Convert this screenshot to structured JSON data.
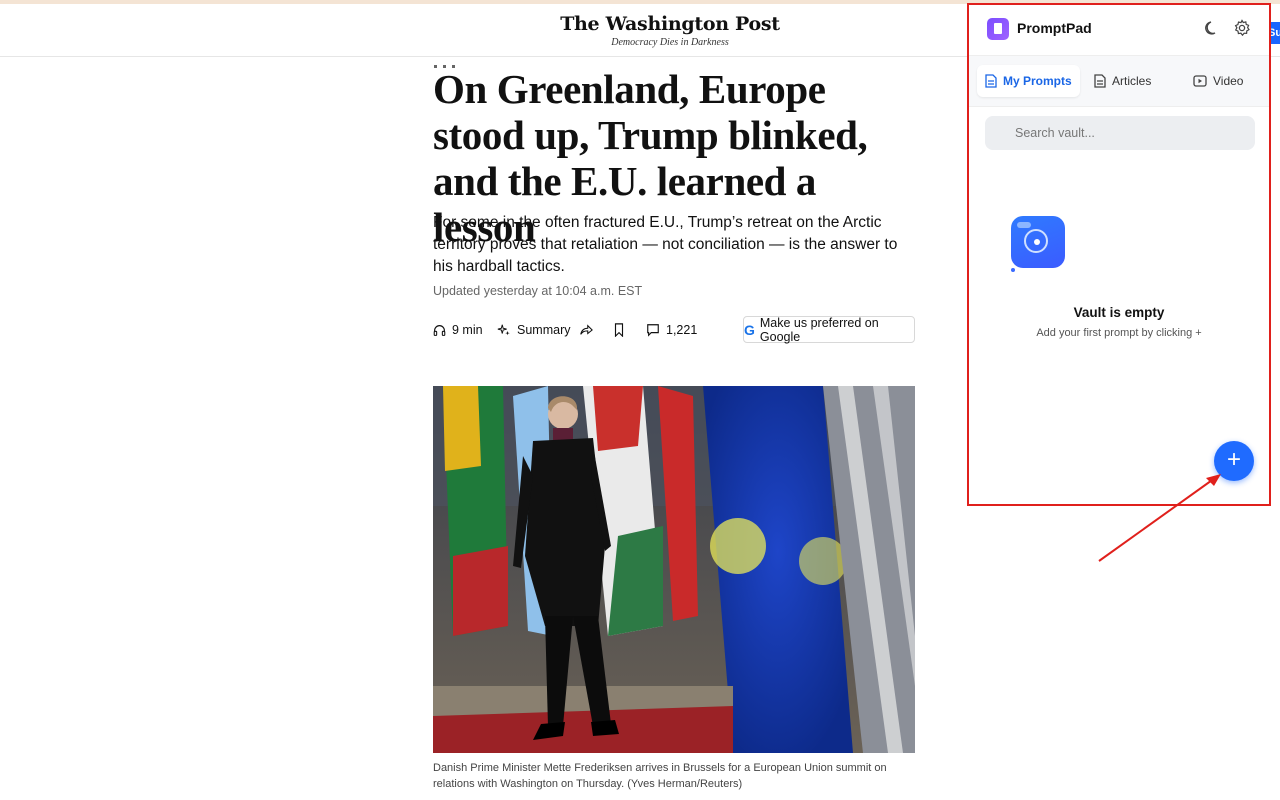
{
  "header": {
    "masthead": "The Washington Post",
    "tagline": "Democracy Dies in Darkness",
    "subscribe_edge": "Su"
  },
  "article": {
    "headline": "On Greenland, Europe stood up, Trump blinked, and the E.U. learned a lesson",
    "dek": "For some in the often fractured E.U., Trump’s retreat on the Arctic territory proves that retaliation — not conciliation — is the answer to his hardball tactics.",
    "updated": "Updated yesterday at 10:04 a.m. EST",
    "actions": {
      "listen": "9 min",
      "summary": "Summary",
      "comments": "1,221",
      "google_button": "Make us preferred on Google",
      "google_mark": "G"
    },
    "caption": "Danish Prime Minister Mette Frederiksen arrives in Brussels for a European Union summit on relations with Washington on Thursday. (Yves Herman/Reuters)"
  },
  "promptpad": {
    "title": "PromptPad",
    "tabs": [
      {
        "label": "My Prompts",
        "icon": "document-icon",
        "active": true
      },
      {
        "label": "Articles",
        "icon": "article-icon",
        "active": false
      },
      {
        "label": "Video",
        "icon": "video-icon",
        "active": false
      }
    ],
    "search": {
      "placeholder": "Search vault..."
    },
    "empty": {
      "title": "Vault is empty",
      "subtitle": "Add your first prompt by clicking +"
    },
    "fab_label": "+",
    "accent": "#1f6bff",
    "highlight_border": "#e0201c"
  },
  "icons": [
    "headphones-icon",
    "sparkle-icon",
    "share-icon",
    "bookmark-icon",
    "comment-icon",
    "moon-icon",
    "gear-icon",
    "search-icon"
  ]
}
